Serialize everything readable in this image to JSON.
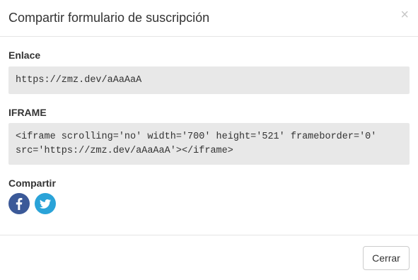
{
  "modal": {
    "title": "Compartir formulario de suscripción",
    "close_glyph": "×"
  },
  "link_section": {
    "label": "Enlace",
    "value": "https://zmz.dev/aAaAaA"
  },
  "iframe_section": {
    "label": "IFRAME",
    "code_line1": "<iframe scrolling='no' width='700' height='521' frameborder='0'",
    "code_line2": "src='https://zmz.dev/aAaAaA'></iframe>"
  },
  "share_section": {
    "label": "Compartir",
    "buttons": [
      {
        "icon": "facebook-icon",
        "color": "#3b5998"
      },
      {
        "icon": "twitter-icon",
        "color": "#2aa3d8"
      }
    ]
  },
  "footer": {
    "close_label": "Cerrar"
  }
}
